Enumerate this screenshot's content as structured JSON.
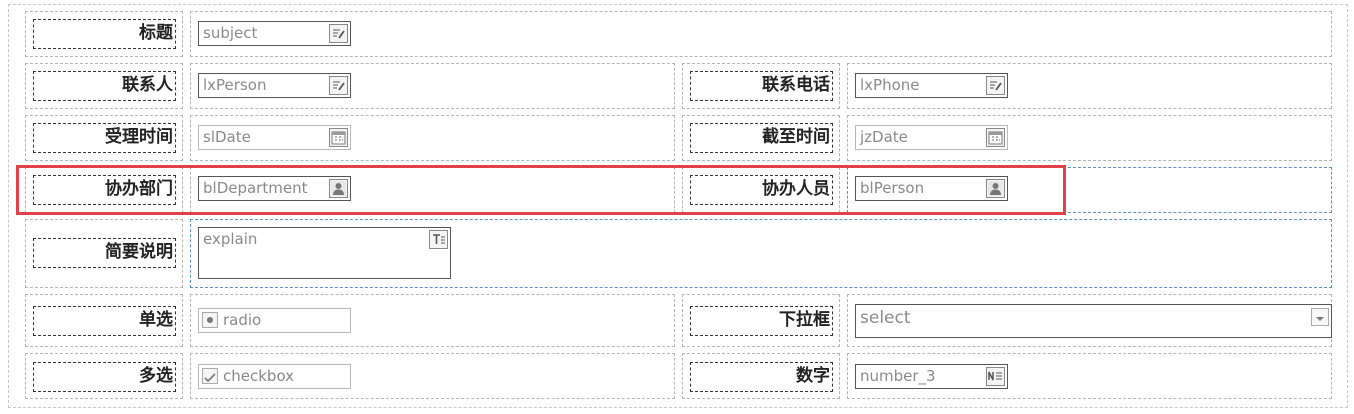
{
  "form": {
    "subject": {
      "label": "标题",
      "value": "subject"
    },
    "lxPerson": {
      "label": "联系人",
      "value": "lxPerson"
    },
    "lxPhone": {
      "label": "联系电话",
      "value": "lxPhone"
    },
    "slDate": {
      "label": "受理时间",
      "value": "slDate"
    },
    "jzDate": {
      "label": "截至时间",
      "value": "jzDate"
    },
    "blDepartment": {
      "label": "协办部门",
      "value": "blDepartment"
    },
    "blPerson": {
      "label": "协办人员",
      "value": "blPerson"
    },
    "explain": {
      "label": "简要说明",
      "value": "explain"
    },
    "radio": {
      "label": "单选",
      "value": "radio"
    },
    "select": {
      "label": "下拉框",
      "value": "select"
    },
    "checkbox": {
      "label": "多选",
      "value": "checkbox"
    },
    "number": {
      "label": "数字",
      "value": "number_3"
    }
  },
  "icons": {
    "text": "edit-icon",
    "date": "calendar-icon",
    "person": "user-icon",
    "textarea": "textarea-icon",
    "select": "dropdown-arrow-icon",
    "number": "number-icon"
  },
  "colors": {
    "highlight": "#e0414a",
    "selected_border": "#5f8fbf"
  }
}
